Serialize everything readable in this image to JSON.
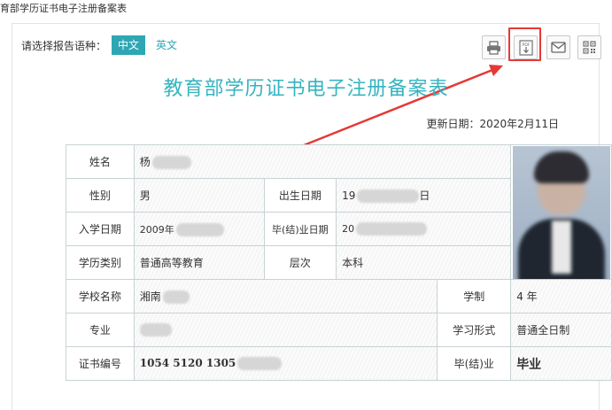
{
  "window": {
    "title": "育部学历证书电子注册备案表"
  },
  "lang": {
    "label": "请选择报告语种：",
    "options": [
      "中文",
      "英文"
    ],
    "selected": "中文"
  },
  "toolbar": {
    "print_icon": "printer-icon",
    "pdf_icon": "pdf-download-icon",
    "mail_icon": "mail-icon",
    "qr_icon": "qrcode-icon",
    "pdf_text": "PDF"
  },
  "doc": {
    "title": "教育部学历证书电子注册备案表",
    "update": "更新日期：2020年2月11日"
  },
  "fields": {
    "name": {
      "label": "姓名",
      "value": "杨"
    },
    "gender": {
      "label": "性别",
      "value": "男"
    },
    "birth": {
      "label": "出生日期",
      "value": "19",
      "tail": "日"
    },
    "enroll": {
      "label": "入学日期",
      "value": "2009年"
    },
    "graduate": {
      "label": "毕(结)业日期",
      "value": "20"
    },
    "edu_type": {
      "label": "学历类别",
      "value": "普通高等教育"
    },
    "level": {
      "label": "层次",
      "value": "本科"
    },
    "school": {
      "label": "学校名称",
      "value": "湘南"
    },
    "duration": {
      "label": "学制",
      "value": "4 年"
    },
    "major": {
      "label": "专业",
      "value": ""
    },
    "study_form": {
      "label": "学习形式",
      "value": "普通全日制"
    },
    "cert_no": {
      "label": "证书编号",
      "value": "1054 5120 1305"
    },
    "grad_status": {
      "label": "毕(结)业",
      "value": "毕业"
    }
  },
  "colors": {
    "accent": "#2ea7b5",
    "title": "#36b4c1",
    "highlight": "#e53935"
  }
}
